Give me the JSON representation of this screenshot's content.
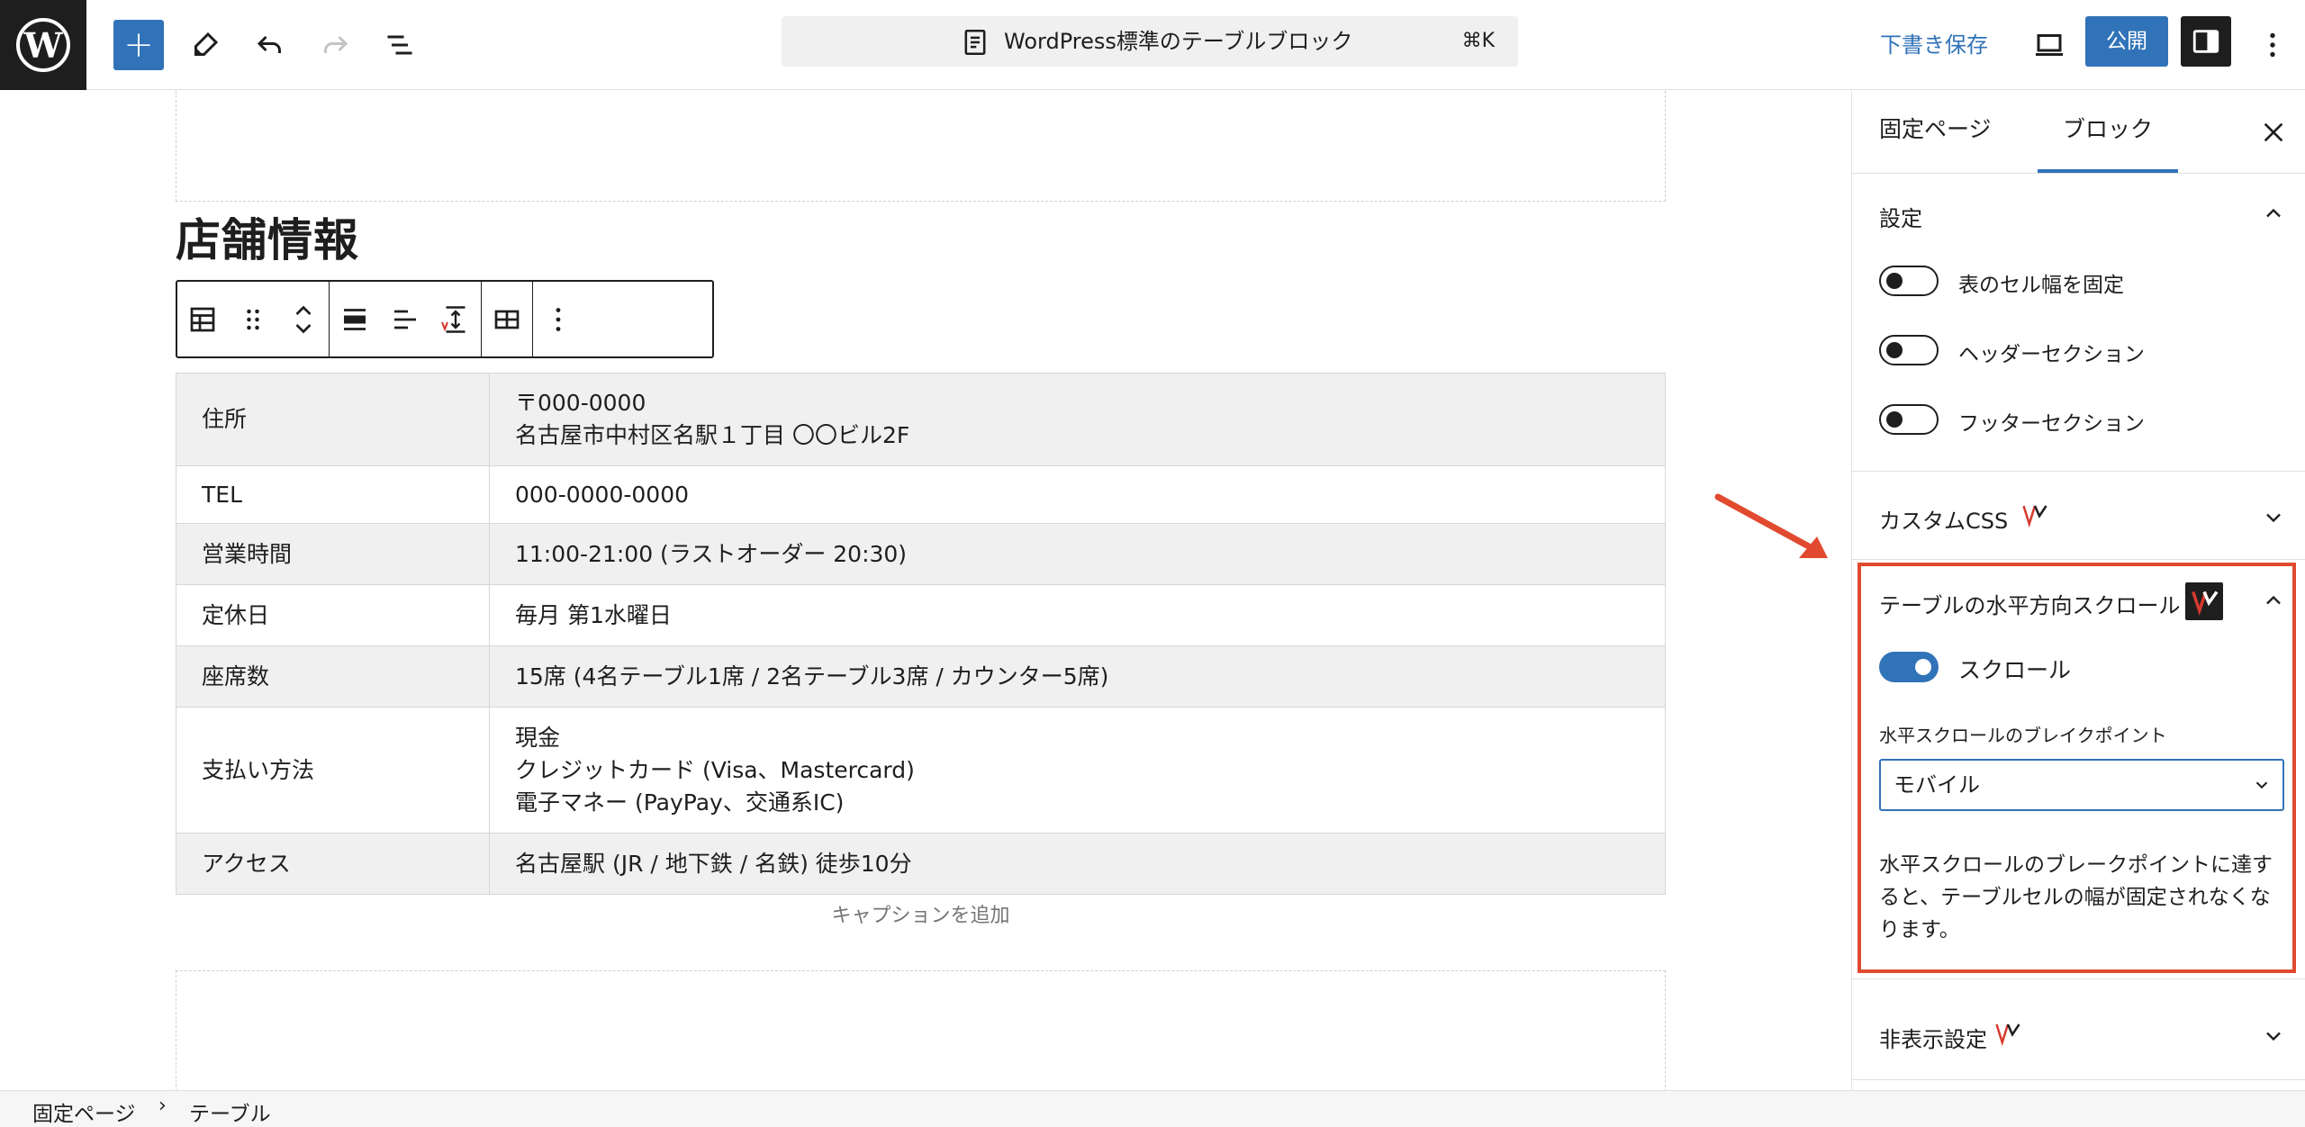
{
  "topbar": {
    "logo_letter": "W",
    "add_label": "+",
    "document_title": "WordPress標準のテーブルブロック",
    "shortcut": "⌘K",
    "save_draft_label": "下書き保存",
    "publish_label": "公開",
    "icons": [
      "wordpress-logo",
      "pen-icon",
      "undo-icon",
      "redo-icon",
      "list-view-icon",
      "document-icon",
      "desktop-preview-icon",
      "sidebar-toggle-icon",
      "more-vertical-icon"
    ]
  },
  "editor": {
    "heading": "店舗情報",
    "caption_placeholder": "キャプションを追加",
    "table": {
      "rows": [
        {
          "key": "住所",
          "lines": [
            "〒000-0000",
            "名古屋市中村区名駅１丁目 〇〇ビル2F"
          ]
        },
        {
          "key": "TEL",
          "lines": [
            "000-0000-0000"
          ]
        },
        {
          "key": "営業時間",
          "lines": [
            "11:00-21:00 (ラストオーダー 20:30)"
          ]
        },
        {
          "key": "定休日",
          "lines": [
            "毎月 第1水曜日"
          ]
        },
        {
          "key": "座席数",
          "lines": [
            "15席 (4名テーブル1席 / 2名テーブル3席 / カウンター5席)"
          ]
        },
        {
          "key": "支払い方法",
          "lines": [
            "現金",
            "クレジットカード (Visa、Mastercard)",
            "電子マネー (PayPay、交通系IC)"
          ]
        },
        {
          "key": "アクセス",
          "lines": [
            "名古屋駅 (JR / 地下鉄 / 名鉄) 徒歩10分"
          ]
        }
      ]
    }
  },
  "sidebar": {
    "tabs": [
      {
        "label": "固定ページ",
        "active": false
      },
      {
        "label": "ブロック",
        "active": true
      }
    ],
    "settings_panel": {
      "title": "設定",
      "toggles": [
        {
          "label": "表のセル幅を固定",
          "on": false
        },
        {
          "label": "ヘッダーセクション",
          "on": false
        },
        {
          "label": "フッターセクション",
          "on": false
        }
      ]
    },
    "custom_css_panel": {
      "title": "カスタムCSS"
    },
    "scroll_panel": {
      "title": "テーブルの水平方向スクロール",
      "toggle_label": "スクロール",
      "toggle_on": true,
      "select_label": "水平スクロールのブレイクポイント",
      "select_value": "モバイル",
      "help": "水平スクロールのブレークポイントに達すると、テーブルセルの幅が固定されなくなります。"
    },
    "hide_panel": {
      "title": "非表示設定"
    }
  },
  "footer": {
    "crumbs": [
      "固定ページ",
      "テーブル"
    ],
    "separator": "›"
  },
  "colors": {
    "accent": "#3173b8",
    "highlight": "#e14a2f",
    "dark": "#1e1e1e"
  }
}
